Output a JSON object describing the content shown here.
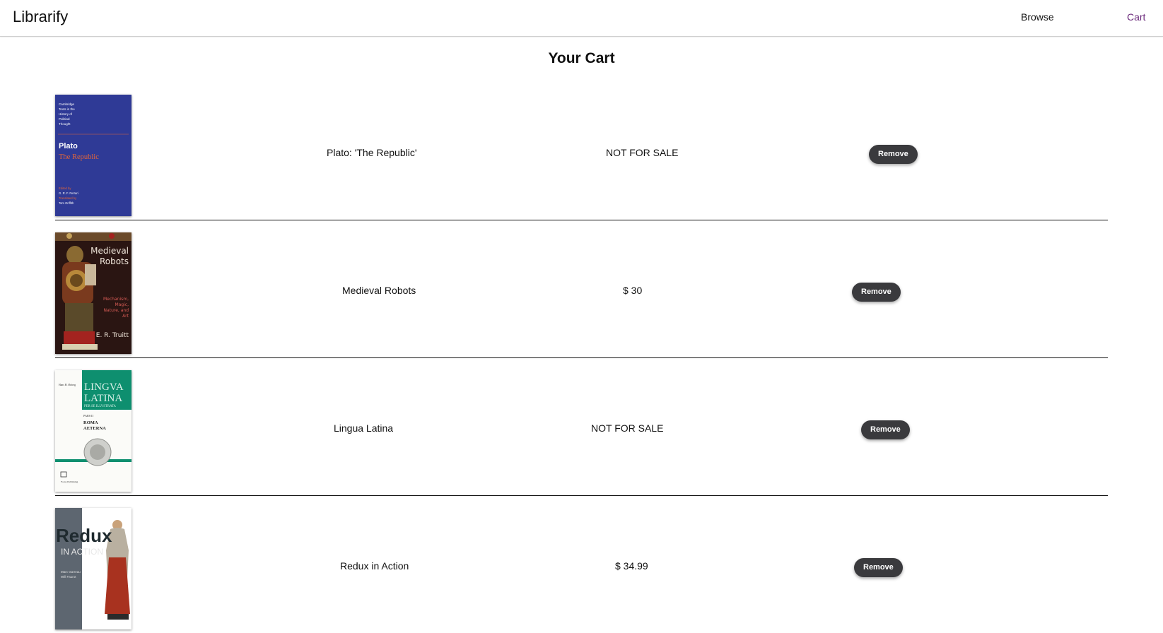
{
  "app": {
    "brand": "Librarify"
  },
  "nav": {
    "browse": "Browse",
    "cart": "Cart"
  },
  "page": {
    "title": "Your Cart"
  },
  "cart": [
    {
      "title": "Plato: 'The Republic'",
      "price": "NOT FOR SALE",
      "remove_label": "Remove",
      "cover": {
        "series": [
          "Cambridge",
          "Texts in the",
          "History of",
          "Political",
          "Thought"
        ],
        "author": "Plato",
        "book": "The Republic",
        "credits": [
          "Edited by",
          "G. R. F. Ferrari",
          "Translated by",
          "Tom Griffith"
        ],
        "colors": {
          "bg": "#2f3a96",
          "accent": "#e0643b"
        }
      }
    },
    {
      "title": "Medieval Robots",
      "price": "$ 30",
      "remove_label": "Remove",
      "cover": {
        "lines": [
          "Medieval",
          "Robots"
        ],
        "subtitle": [
          "Mechanism,",
          "Magic,",
          "Nature, and",
          "Art"
        ],
        "author": "E. R. Truitt",
        "colors": {
          "bg": "#2a1512",
          "accent": "#a3231f"
        }
      }
    },
    {
      "title": "Lingua Latina",
      "price": "NOT FOR SALE",
      "remove_label": "Remove",
      "cover": {
        "author": "Hans H. Ørberg",
        "lines": [
          "LINGVA",
          "LATINA"
        ],
        "subtitle": "PER SE ILLVSTRATA",
        "part": "PARS II",
        "book": [
          "ROMA",
          "AETERNA"
        ],
        "publisher": "Focus Publishing",
        "colors": {
          "band": "#0e8f6f"
        }
      }
    },
    {
      "title": "Redux in Action",
      "price": "$ 34.99",
      "remove_label": "Remove",
      "cover": {
        "lines": [
          "Redux",
          "IN ACTION"
        ],
        "authors": [
          "Marc Garreau",
          "Will Faurot"
        ],
        "colors": {
          "bg": "#5d6670"
        }
      }
    }
  ]
}
